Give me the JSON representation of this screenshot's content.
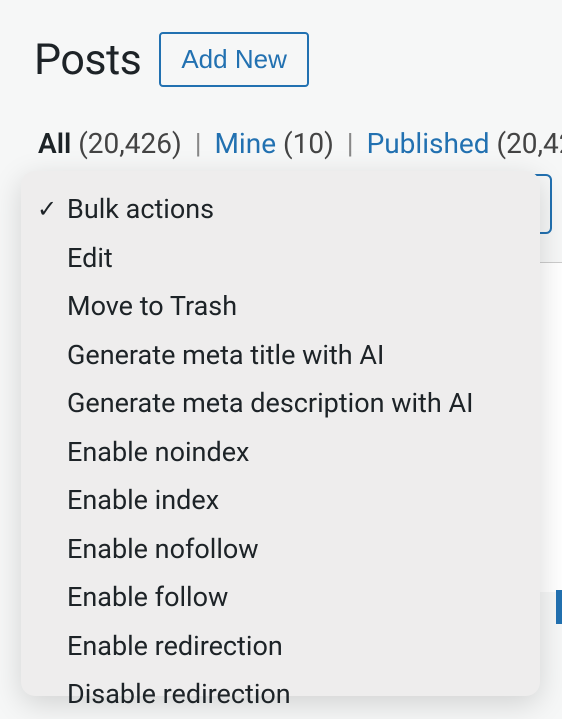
{
  "header": {
    "title": "Posts",
    "add_new_label": "Add New"
  },
  "filters": {
    "all": {
      "label": "All",
      "count": "(20,426)"
    },
    "mine": {
      "label": "Mine",
      "count": "(10)"
    },
    "published": {
      "label": "Published",
      "count": "(20,42"
    },
    "separator": "|"
  },
  "dropdown": {
    "items": [
      {
        "label": "Bulk actions",
        "checked": true
      },
      {
        "label": "Edit",
        "checked": false
      },
      {
        "label": "Move to Trash",
        "checked": false
      },
      {
        "label": "Generate meta title with AI",
        "checked": false
      },
      {
        "label": "Generate meta description with AI",
        "checked": false
      },
      {
        "label": "Enable noindex",
        "checked": false
      },
      {
        "label": "Enable index",
        "checked": false
      },
      {
        "label": "Enable nofollow",
        "checked": false
      },
      {
        "label": "Enable follow",
        "checked": false
      },
      {
        "label": "Enable redirection",
        "checked": false
      },
      {
        "label": "Disable redirection",
        "checked": false
      }
    ]
  }
}
